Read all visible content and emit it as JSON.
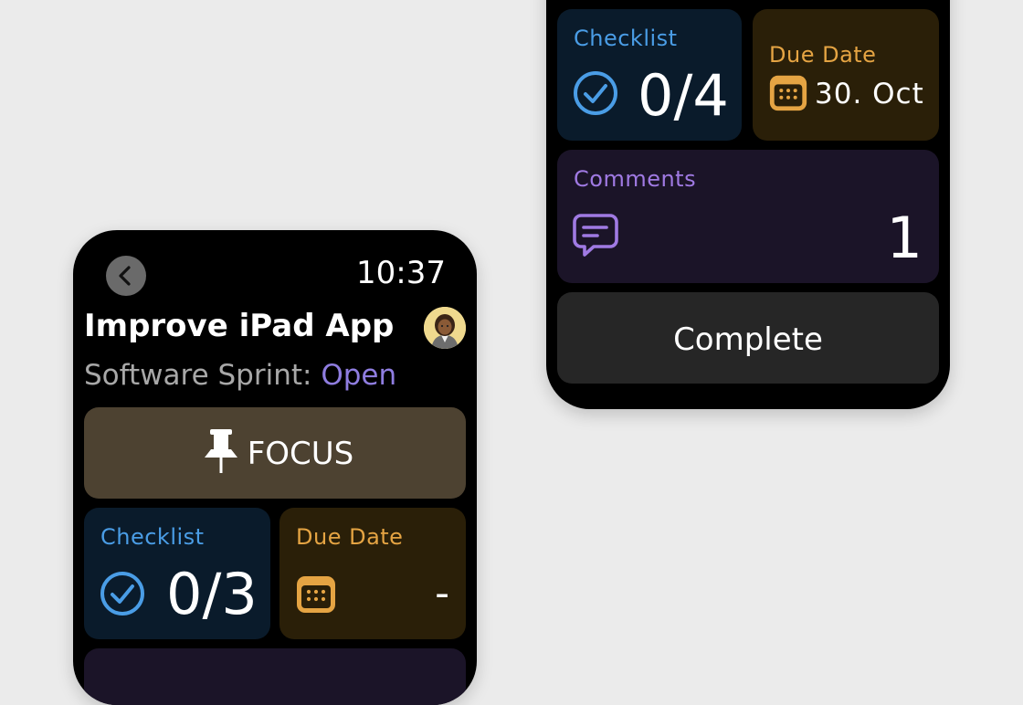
{
  "left_watch": {
    "clock": "10:37",
    "title": "Improve iPad App",
    "subtitle_project": "Software Sprint:",
    "subtitle_status": "Open",
    "focus_label": "FOCUS",
    "checklist_label": "Checklist",
    "checklist_value": "0/3",
    "due_label": "Due Date",
    "due_value": "-"
  },
  "right_watch": {
    "checklist_label": "Checklist",
    "checklist_value": "0/4",
    "due_label": "Due Date",
    "due_value": "30. Oct",
    "comments_label": "Comments",
    "comments_value": "1",
    "complete_label": "Complete"
  },
  "colors": {
    "checklist_accent": "#4a9de6",
    "due_accent": "#e5a443",
    "comments_accent": "#a07ae3",
    "status_accent": "#8f7de0"
  },
  "icons": [
    "chevron-left-icon",
    "avatar",
    "pin-icon",
    "checkmark-circle-icon",
    "calendar-icon",
    "comment-bubble-icon"
  ]
}
